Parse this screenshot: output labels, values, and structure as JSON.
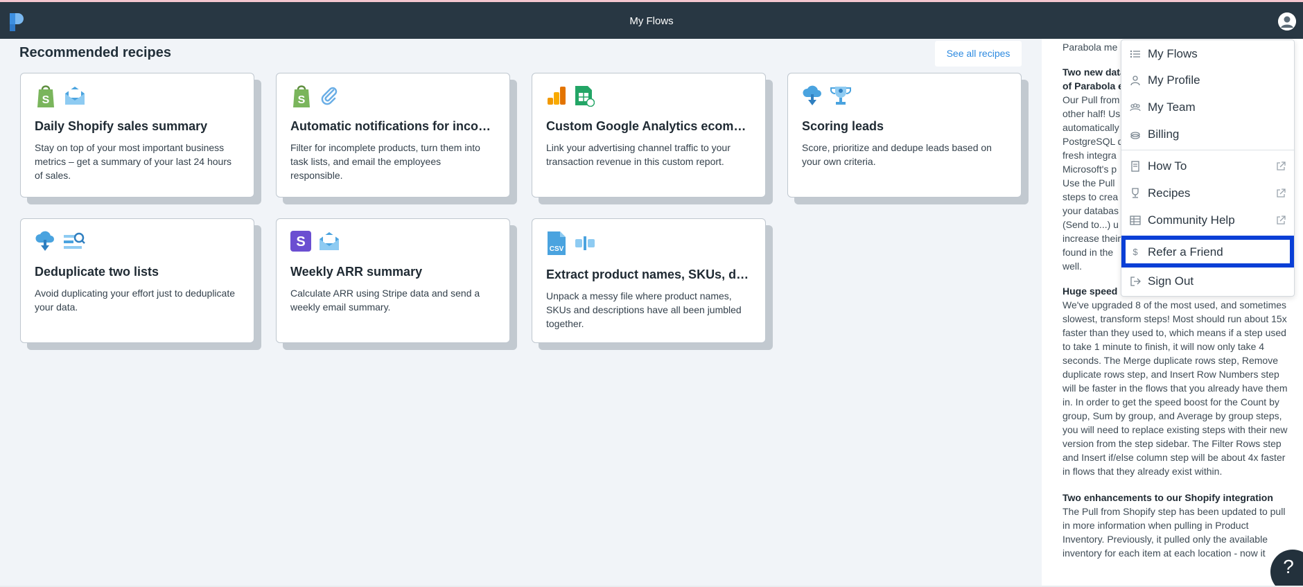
{
  "header": {
    "title": "My Flows",
    "logo_icon": "parabola-logo-icon",
    "avatar_icon": "user-avatar-icon",
    "bar_color": "#283743"
  },
  "main": {
    "section_title": "Recommended recipes",
    "see_all_label": "See all recipes",
    "cards": [
      {
        "title": "Daily Shopify sales summary",
        "description": "Stay on top of your most important business metrics – get a summary of your last 24 hours of sales.",
        "icons": [
          "shopify-icon",
          "email-icon"
        ]
      },
      {
        "title": "Automatic notifications for incom...",
        "description": "Filter for incomplete products, turn them into task lists, and email the employees responsible.",
        "icons": [
          "shopify-icon",
          "paperclip-icon"
        ]
      },
      {
        "title": "Custom Google Analytics ecomm...",
        "description": "Link your advertising channel traffic to your transaction revenue in this custom report.",
        "icons": [
          "google-analytics-icon",
          "google-sheets-icon"
        ]
      },
      {
        "title": "Scoring leads",
        "description": "Score, prioritize and dedupe leads based on your own criteria.",
        "icons": [
          "cloud-download-icon",
          "trophy-icon"
        ]
      },
      {
        "title": "Deduplicate two lists",
        "description": "Avoid duplicating your effort just to deduplicate your data.",
        "icons": [
          "cloud-download-icon",
          "search-list-icon"
        ]
      },
      {
        "title": "Weekly ARR summary",
        "description": "Calculate ARR using Stripe data and send a weekly email summary.",
        "icons": [
          "stripe-icon",
          "email-icon"
        ]
      },
      {
        "title": "Extract product names, SKUs, des...",
        "description": "Unpack a messy file where product names, SKUs and descriptions have all been jumbled together.",
        "icons": [
          "csv-file-icon",
          "split-column-icon"
        ]
      }
    ]
  },
  "news": {
    "lines_top": [
      "Parabola me"
    ],
    "heading1": "Two new data",
    "heading1b": "of Parabola e",
    "body1": [
      "Our Pull from",
      "other half! Us",
      "automatically",
      "PostgreSQL d",
      "fresh integra",
      "Microsoft's p",
      "Use the Pull",
      "steps to crea",
      "your databas",
      "(Send to...) u",
      "increase their",
      "found in the",
      "well."
    ],
    "heading2": "Huge speed improvements for 8 slow steps",
    "body2": "We've upgraded 8 of the most used, and sometimes slowest, transform steps! Most should run about 15x faster than they used to, which means if a step used to take 1 minute to finish, it will now only take 4 seconds. The Merge duplicate rows step, Remove duplicate rows step, and Insert Row Numbers step will be faster in the flows that you already have them in. In order to get the speed boost for the Count by group, Sum by group, and Average by group steps, you will need to replace existing steps with their new version from the step sidebar. The Filter Rows step and Insert if/else column step will be about 4x faster in flows that they already exist within.",
    "heading3": "Two enhancements to our Shopify integration",
    "body3": "The Pull from Shopify step has been updated to pull in more information when pulling in Product Inventory. Previously, it pulled only the available inventory for each item at each location - now it"
  },
  "menu": {
    "items": [
      {
        "label": "My Flows",
        "icon": "list-icon",
        "external": false
      },
      {
        "label": "My Profile",
        "icon": "person-icon",
        "external": false
      },
      {
        "label": "My Team",
        "icon": "team-icon",
        "external": false
      },
      {
        "label": "Billing",
        "icon": "billing-icon",
        "external": false
      },
      {
        "label": "How To",
        "icon": "book-icon",
        "external": true
      },
      {
        "label": "Recipes",
        "icon": "trophy-icon",
        "external": true
      },
      {
        "label": "Community Help",
        "icon": "table-icon",
        "external": true
      },
      {
        "label": "Refer a Friend",
        "icon": "dollar-icon",
        "external": false
      },
      {
        "label": "Sign Out",
        "icon": "sign-out-icon",
        "external": false
      }
    ],
    "highlight_color": "#0a3fd6"
  },
  "help": {
    "label": "?"
  }
}
